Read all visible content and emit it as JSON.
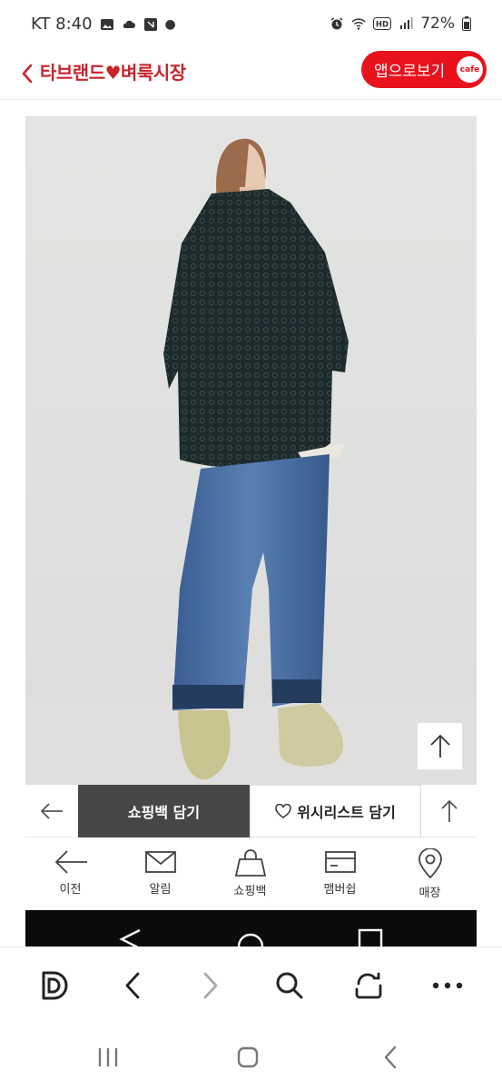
{
  "status_bar": {
    "carrier_time": "KT 8:40",
    "battery": "72%",
    "icons_left": [
      "image-icon",
      "cloud-icon",
      "nfc-icon",
      "dot-icon"
    ],
    "icons_right": [
      "alarm-icon",
      "wifi-icon",
      "hd-icon",
      "signal-icon",
      "battery-icon"
    ]
  },
  "header": {
    "title": "타브랜드♥벼룩시장",
    "app_button_label": "앱으로보기",
    "app_badge": "cafe",
    "accent_color": "#e8111c"
  },
  "action_bar": {
    "cart_label": "쇼핑백 담기",
    "wish_label": "위시리스트 담기"
  },
  "bottom_nav": {
    "items": [
      {
        "label": "이전",
        "icon": "back-arrow-icon"
      },
      {
        "label": "알림",
        "icon": "mail-icon"
      },
      {
        "label": "쇼핑백",
        "icon": "shopping-bag-icon"
      },
      {
        "label": "맴버쉽",
        "icon": "card-icon"
      },
      {
        "label": "매장",
        "icon": "location-pin-icon"
      }
    ]
  },
  "browser_toolbar": {
    "items": [
      "d-logo-icon",
      "back-icon",
      "forward-icon",
      "search-icon",
      "tabs-icon",
      "more-icon"
    ]
  },
  "system_nav": {
    "items": [
      "recents-icon",
      "home-icon",
      "back-icon"
    ]
  }
}
